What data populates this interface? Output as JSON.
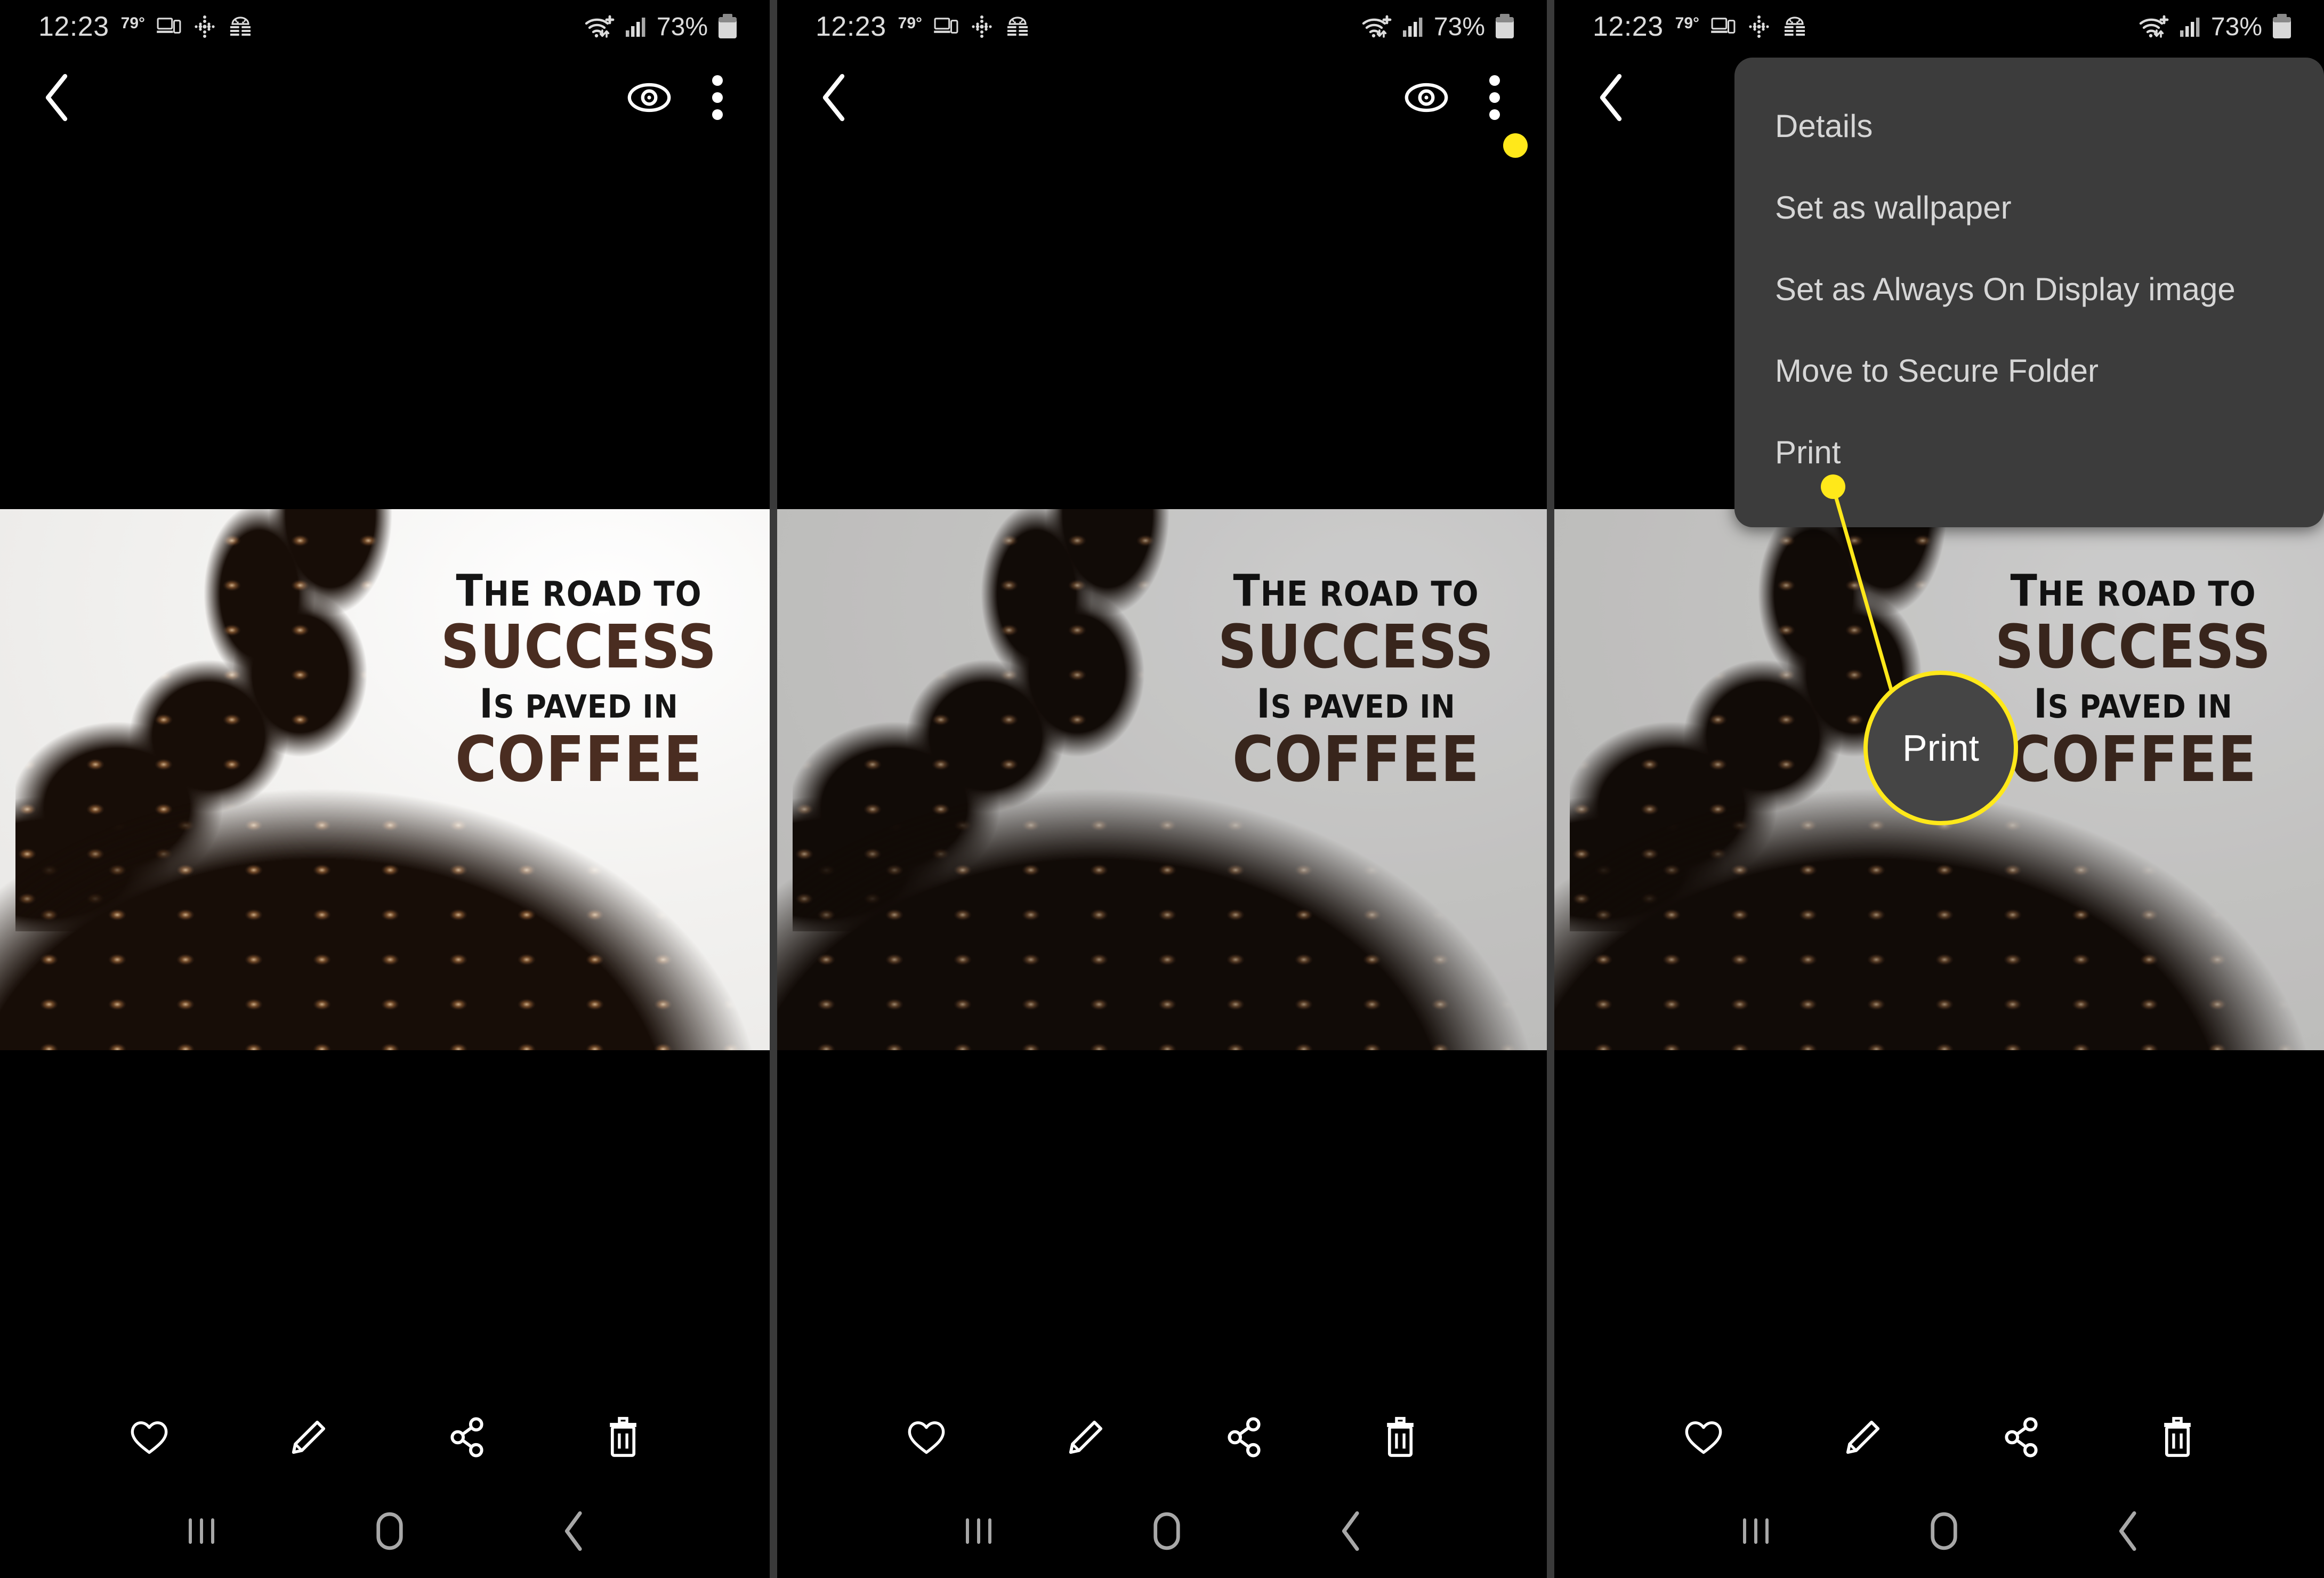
{
  "status_bar": {
    "clock": "12:23",
    "temperature": "79°",
    "battery_percent": "73%",
    "icons_left": [
      "multi-device-icon",
      "dotted-diamond-icon",
      "android-beehive-icon"
    ],
    "icons_right": [
      "wifi-plus-icon",
      "cellular-signal-icon",
      "battery-icon"
    ]
  },
  "app_bar": {
    "back": "back-chevron-icon",
    "view": "eye-icon",
    "overflow": "overflow-menu-icon"
  },
  "photo": {
    "line1_cap": "T",
    "line1": "HE ROAD TO",
    "line2": "SUCCESS",
    "line3_cap": "I",
    "line3": "S PAVED IN",
    "line4": "COFFEE",
    "dark_text_color": "#151515",
    "brown_text_color": "#4a2d21"
  },
  "action_bar": {
    "items": [
      {
        "name": "favorite-button",
        "icon": "heart-icon"
      },
      {
        "name": "edit-button",
        "icon": "pencil-icon"
      },
      {
        "name": "share-button",
        "icon": "share-icon"
      },
      {
        "name": "delete-button",
        "icon": "trash-icon"
      }
    ]
  },
  "nav_bar": {
    "items": [
      {
        "name": "recents-button",
        "icon": "recents-icon"
      },
      {
        "name": "home-button",
        "icon": "home-icon"
      },
      {
        "name": "back-button",
        "icon": "back-icon"
      }
    ]
  },
  "overflow_menu": {
    "items": [
      "Details",
      "Set as wallpaper",
      "Set as Always On Display image",
      "Move to Secure Folder",
      "Print"
    ],
    "background": "#3c3c3c",
    "text_color": "#d6d6d6"
  },
  "callouts": {
    "accent_color": "#ffe81a",
    "panel2": {
      "target": "overflow-menu-icon",
      "magnified_label": ""
    },
    "panel3": {
      "target": "Print",
      "magnified_label": "Print"
    }
  },
  "panels": [
    {
      "id": "panel-1",
      "state": "viewer"
    },
    {
      "id": "panel-2",
      "state": "viewer-with-overflow-callout"
    },
    {
      "id": "panel-3",
      "state": "overflow-menu-open-print-callout"
    }
  ]
}
